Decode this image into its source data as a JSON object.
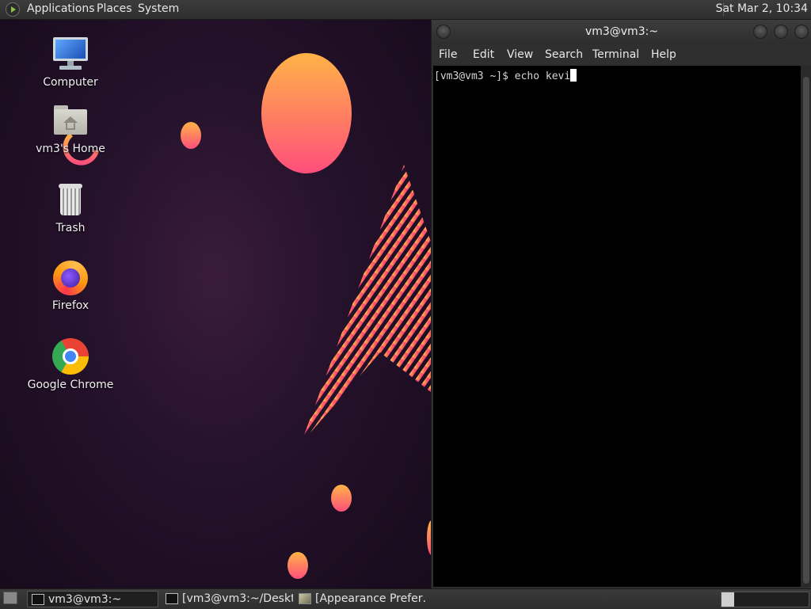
{
  "top_panel": {
    "menus": [
      "Applications",
      "Places",
      "System"
    ],
    "clock": "Sat Mar  2, 10:34"
  },
  "desktop": {
    "icons": [
      {
        "label": "Computer",
        "icon": "computer-icon"
      },
      {
        "label": "vm3's Home",
        "icon": "home-folder-icon"
      },
      {
        "label": "Trash",
        "icon": "trash-icon"
      },
      {
        "label": "Firefox",
        "icon": "firefox-icon"
      },
      {
        "label": "Google Chrome",
        "icon": "chrome-icon"
      }
    ]
  },
  "terminal": {
    "title": "vm3@vm3:~",
    "menus": [
      "File",
      "Edit",
      "View",
      "Search",
      "Terminal",
      "Help"
    ],
    "prompt": "[vm3@vm3 ~]$ echo kevi"
  },
  "taskbar": {
    "tasks": [
      {
        "label": "vm3@vm3:~",
        "icon": "terminal-icon",
        "active": true
      },
      {
        "label": "[vm3@vm3:~/Deskt…",
        "icon": "terminal-icon",
        "active": false
      },
      {
        "label": "[Appearance Prefer…",
        "icon": "appearance-icon",
        "active": false
      }
    ]
  },
  "colors": {
    "accent_orange": "#ff9a3c",
    "accent_pink": "#ff3d7f",
    "desktop_bg": "#24112a"
  }
}
